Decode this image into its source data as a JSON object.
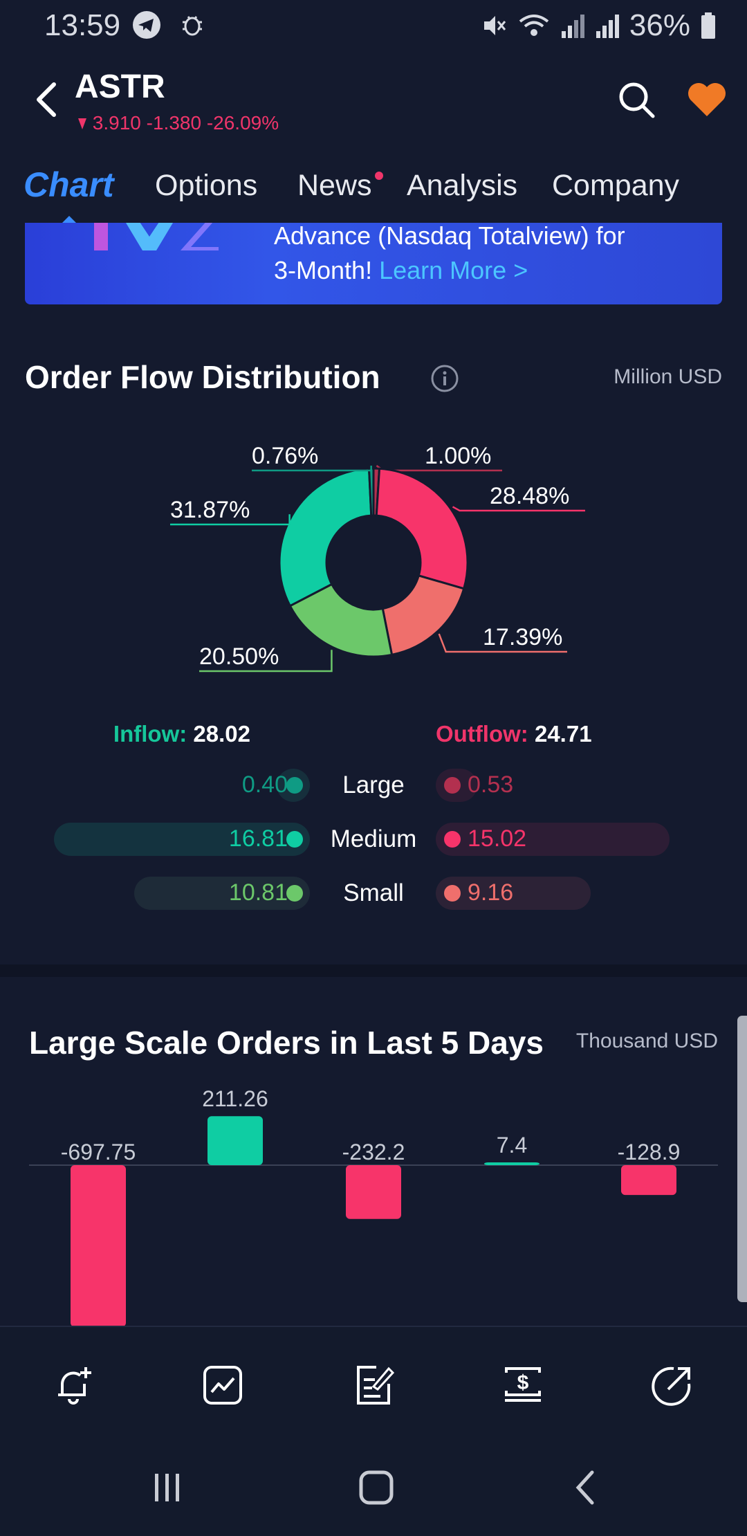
{
  "status_bar": {
    "time": "13:59",
    "battery": "36%"
  },
  "header": {
    "ticker": "ASTR",
    "price": "3.910",
    "change": "-1.380",
    "change_pct": "-26.09%"
  },
  "tabs": [
    {
      "label": "Chart"
    },
    {
      "label": "Options"
    },
    {
      "label": "News"
    },
    {
      "label": "Analysis"
    },
    {
      "label": "Company"
    }
  ],
  "promo": {
    "line1": "Advance (Nasdaq Totalview) for",
    "line2": "3-Month!",
    "link": "Learn More >"
  },
  "order_flow": {
    "title": "Order Flow Distribution",
    "unit": "Million USD",
    "inflow_label": "Inflow:",
    "inflow_total": "28.02",
    "outflow_label": "Outflow:",
    "outflow_total": "24.71",
    "rows": [
      {
        "label": "Large",
        "inflow": "0.40",
        "outflow": "0.53"
      },
      {
        "label": "Medium",
        "inflow": "16.81",
        "outflow": "15.02"
      },
      {
        "label": "Small",
        "inflow": "10.81",
        "outflow": "9.16"
      }
    ],
    "colors": {
      "inflow_large": "#0f9b84",
      "inflow_medium": "#0fcda3",
      "inflow_small": "#6cc86a",
      "outflow_large": "#b3304f",
      "outflow_medium": "#f7346a",
      "outflow_small": "#ef6f6c",
      "inflow_text": "#16c79a",
      "outflow_text": "#f0356a"
    }
  },
  "chart_data": [
    {
      "type": "pie",
      "title": "Order Flow Distribution",
      "slices": [
        {
          "label": "1.00%",
          "value": 1.0
        },
        {
          "label": "28.48%",
          "value": 28.48
        },
        {
          "label": "17.39%",
          "value": 17.39
        },
        {
          "label": "20.50%",
          "value": 20.5
        },
        {
          "label": "31.87%",
          "value": 31.87
        },
        {
          "label": "0.76%",
          "value": 0.76
        }
      ]
    },
    {
      "type": "bar",
      "title": "Large Scale Orders in Last 5 Days",
      "unit": "Thousand USD",
      "values": [
        -697.75,
        211.26,
        -232.2,
        7.4,
        -128.9
      ],
      "labels": [
        "-697.75",
        "211.26",
        "-232.2",
        "7.4",
        "-128.9"
      ]
    }
  ],
  "large_orders": {
    "title": "Large Scale Orders in Last 5 Days",
    "unit": "Thousand USD"
  }
}
